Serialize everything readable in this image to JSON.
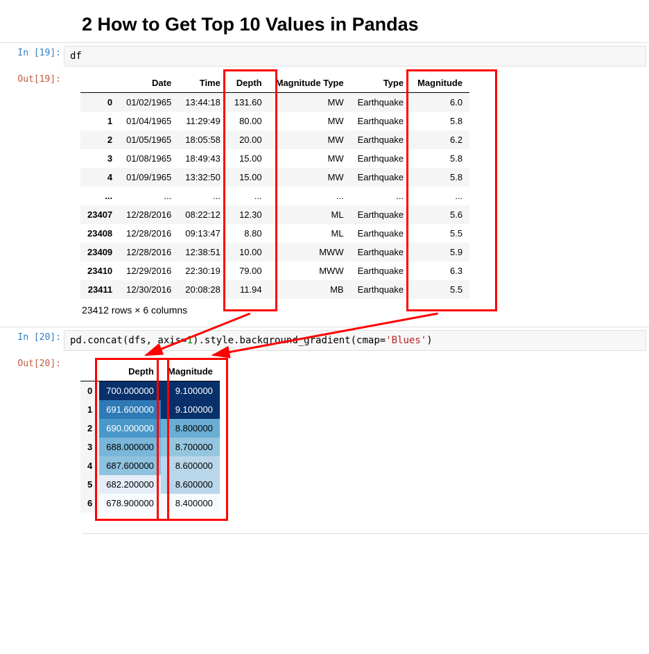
{
  "heading": "2  How to Get Top 10 Values in Pandas",
  "cell1": {
    "in_prompt": "In [19]:",
    "out_prompt": "Out[19]:",
    "code": "df"
  },
  "ellipsis": "...",
  "df1": {
    "headers": [
      "",
      "Date",
      "Time",
      "Depth",
      "Magnitude Type",
      "Type",
      "Magnitude"
    ],
    "rows": [
      {
        "idx": "0",
        "Date": "01/02/1965",
        "Time": "13:44:18",
        "Depth": "131.60",
        "MagType": "MW",
        "Type": "Earthquake",
        "Magnitude": "6.0"
      },
      {
        "idx": "1",
        "Date": "01/04/1965",
        "Time": "11:29:49",
        "Depth": "80.00",
        "MagType": "MW",
        "Type": "Earthquake",
        "Magnitude": "5.8"
      },
      {
        "idx": "2",
        "Date": "01/05/1965",
        "Time": "18:05:58",
        "Depth": "20.00",
        "MagType": "MW",
        "Type": "Earthquake",
        "Magnitude": "6.2"
      },
      {
        "idx": "3",
        "Date": "01/08/1965",
        "Time": "18:49:43",
        "Depth": "15.00",
        "MagType": "MW",
        "Type": "Earthquake",
        "Magnitude": "5.8"
      },
      {
        "idx": "4",
        "Date": "01/09/1965",
        "Time": "13:32:50",
        "Depth": "15.00",
        "MagType": "MW",
        "Type": "Earthquake",
        "Magnitude": "5.8"
      },
      {
        "idx": "...",
        "Date": "...",
        "Time": "...",
        "Depth": "...",
        "MagType": "...",
        "Type": "...",
        "Magnitude": "..."
      },
      {
        "idx": "23407",
        "Date": "12/28/2016",
        "Time": "08:22:12",
        "Depth": "12.30",
        "MagType": "ML",
        "Type": "Earthquake",
        "Magnitude": "5.6"
      },
      {
        "idx": "23408",
        "Date": "12/28/2016",
        "Time": "09:13:47",
        "Depth": "8.80",
        "MagType": "ML",
        "Type": "Earthquake",
        "Magnitude": "5.5"
      },
      {
        "idx": "23409",
        "Date": "12/28/2016",
        "Time": "12:38:51",
        "Depth": "10.00",
        "MagType": "MWW",
        "Type": "Earthquake",
        "Magnitude": "5.9"
      },
      {
        "idx": "23410",
        "Date": "12/29/2016",
        "Time": "22:30:19",
        "Depth": "79.00",
        "MagType": "MWW",
        "Type": "Earthquake",
        "Magnitude": "6.3"
      },
      {
        "idx": "23411",
        "Date": "12/30/2016",
        "Time": "20:08:28",
        "Depth": "11.94",
        "MagType": "MB",
        "Type": "Earthquake",
        "Magnitude": "5.5"
      }
    ],
    "shape_note": "23412 rows × 6 columns"
  },
  "cell2": {
    "in_prompt": "In [20]:",
    "out_prompt": "Out[20]:",
    "code_tokens": [
      {
        "t": "pd.concat(dfs, axis",
        "c": "plain"
      },
      {
        "t": "=",
        "c": "plain"
      },
      {
        "t": "1",
        "c": "num"
      },
      {
        "t": ").style.background_gradient(cmap",
        "c": "plain"
      },
      {
        "t": "=",
        "c": "plain"
      },
      {
        "t": "'Blues'",
        "c": "str"
      },
      {
        "t": ")",
        "c": "plain"
      }
    ]
  },
  "df2": {
    "headers": [
      "",
      "Depth",
      "Magnitude"
    ],
    "rows": [
      {
        "idx": "0",
        "Depth": "700.000000",
        "Magnitude": "9.100000",
        "dC": "#08306b",
        "mC": "#08306b",
        "dF": "#fff",
        "mF": "#fff"
      },
      {
        "idx": "1",
        "Depth": "691.600000",
        "Magnitude": "9.100000",
        "dC": "#2e79b6",
        "mC": "#08306b",
        "dF": "#fff",
        "mF": "#fff"
      },
      {
        "idx": "2",
        "Depth": "690.000000",
        "Magnitude": "8.800000",
        "dC": "#4a97c9",
        "mC": "#6aaed6",
        "dF": "#fff",
        "mF": "#000"
      },
      {
        "idx": "3",
        "Depth": "688.000000",
        "Magnitude": "8.700000",
        "dC": "#7ab6d9",
        "mC": "#96c6df",
        "dF": "#000",
        "mF": "#000"
      },
      {
        "idx": "4",
        "Depth": "687.600000",
        "Magnitude": "8.600000",
        "dC": "#8fc2de",
        "mC": "#bad6ea",
        "dF": "#000",
        "mF": "#000"
      },
      {
        "idx": "5",
        "Depth": "682.200000",
        "Magnitude": "8.600000",
        "dC": "#e5eef8",
        "mC": "#bad6ea",
        "dF": "#000",
        "mF": "#000"
      },
      {
        "idx": "6",
        "Depth": "678.900000",
        "Magnitude": "8.400000",
        "dC": "#f7fbff",
        "mC": "#f7fbff",
        "dF": "#000",
        "mF": "#000"
      }
    ]
  }
}
